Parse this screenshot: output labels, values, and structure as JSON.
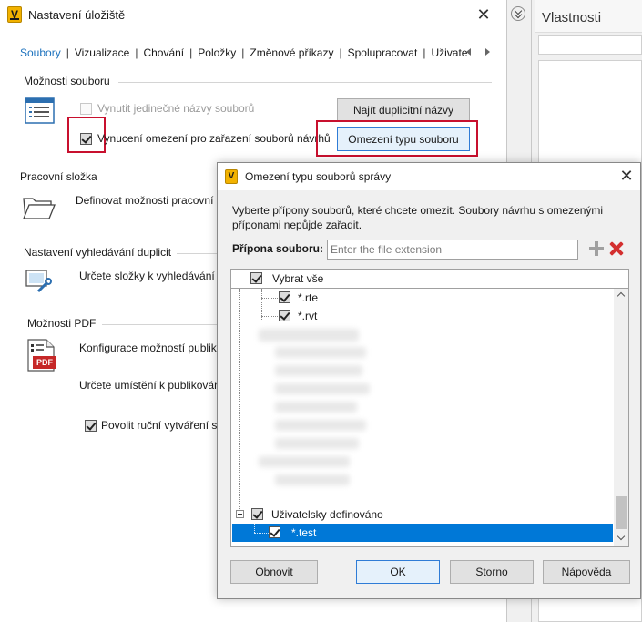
{
  "main_window": {
    "title": "Nastavení úložiště",
    "tabs": [
      "Soubory",
      "Vizualizace",
      "Chování",
      "Položky",
      "Změnové příkazy",
      "Spolupracovat",
      "Uživate"
    ],
    "sections": {
      "file_options": {
        "title": "Možnosti souboru",
        "unique_names": "Vynutit jedinečné názvy souborů",
        "enforce_restrictions": "Vynucení omezení pro zařazení souborů návrhů",
        "find_duplicates_button": "Najít duplicitní názvy",
        "type_restriction_button": "Omezení typu souboru"
      },
      "working_folder": {
        "title": "Pracovní složka",
        "text": "Definovat možnosti pracovní"
      },
      "duplicate_search": {
        "title": "Nastavení vyhledávání duplicit",
        "text": "Určete složky k vyhledávání d"
      },
      "pdf_options": {
        "title": "Možnosti PDF",
        "text1": "Konfigurace možností publik",
        "text2": "Určete umístění k publikován",
        "allow_manual": "Povolit ruční vytváření s",
        "pdf_badge": "PDF"
      }
    }
  },
  "right_pane": {
    "title": "Vlastnosti"
  },
  "dialog": {
    "title": "Omezení typu souborů správy",
    "description": "Vyberte přípony souborů, které chcete omezit. Soubory návrhu s omezenými příponami nepůjde zařadit.",
    "extension_label": "Přípona souboru:",
    "extension_placeholder": "Enter the file extension",
    "select_all": "Vybrat vše",
    "tree_items": [
      "*.rte",
      "*.rvt"
    ],
    "user_defined": "Uživatelsky definováno",
    "user_defined_items": [
      "*.test"
    ],
    "buttons": {
      "refresh": "Obnovit",
      "ok": "OK",
      "cancel": "Storno",
      "help": "Nápověda"
    }
  },
  "app_icon_letter": "V",
  "colors": {
    "accent": "#1e73be",
    "highlight": "#c8102e",
    "selection": "#0078d7",
    "app_icon": "#f2b200"
  }
}
